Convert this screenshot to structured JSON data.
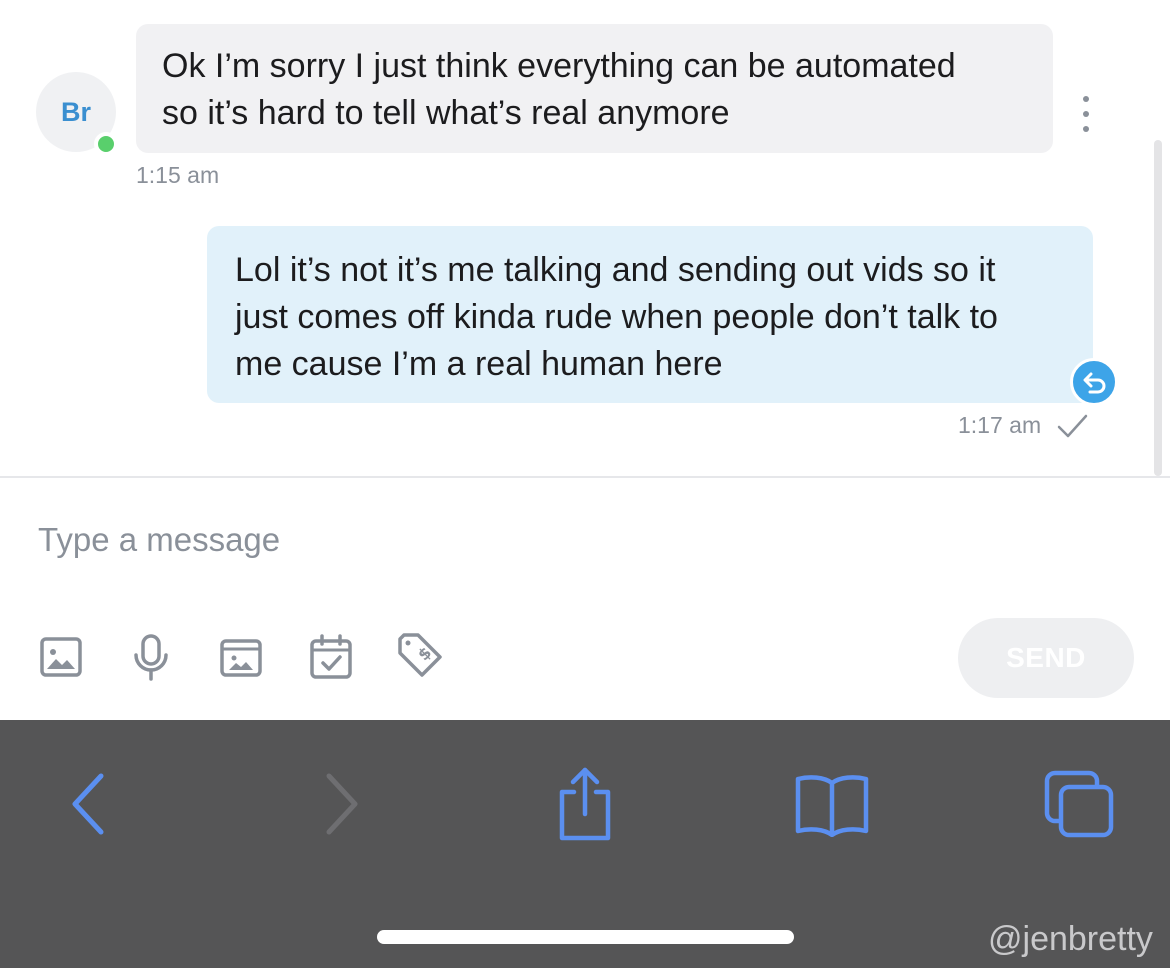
{
  "conversation": {
    "avatar_initials": "Br",
    "incoming": {
      "lines": [
        "Ok I’m sorry I just think everything can be automated",
        "so it’s hard to tell what’s real anymore"
      ],
      "time": "1:15 am"
    },
    "outgoing": {
      "lines": [
        "Lol it’s not it’s me talking and sending out vids so it",
        "just comes off kinda rude when people don’t talk to",
        "me cause I’m a real human here"
      ],
      "time": "1:17 am"
    }
  },
  "composer": {
    "placeholder": "Type a message",
    "send_label": "SEND",
    "tools": [
      "image-icon",
      "microphone-icon",
      "media-vault-icon",
      "calendar-check-icon",
      "price-tag-icon"
    ]
  },
  "browser": {
    "buttons": [
      "back-icon",
      "forward-icon",
      "share-icon",
      "bookmarks-icon",
      "tabs-icon"
    ]
  },
  "watermark": "@jenbretty",
  "colors": {
    "incoming_bubble": "#f1f1f3",
    "outgoing_bubble": "#e1f1fa",
    "accent": "#3da4e8",
    "online": "#59cf6c",
    "browser_icon": "#5b8ff0",
    "browser_bar": "#555556"
  }
}
